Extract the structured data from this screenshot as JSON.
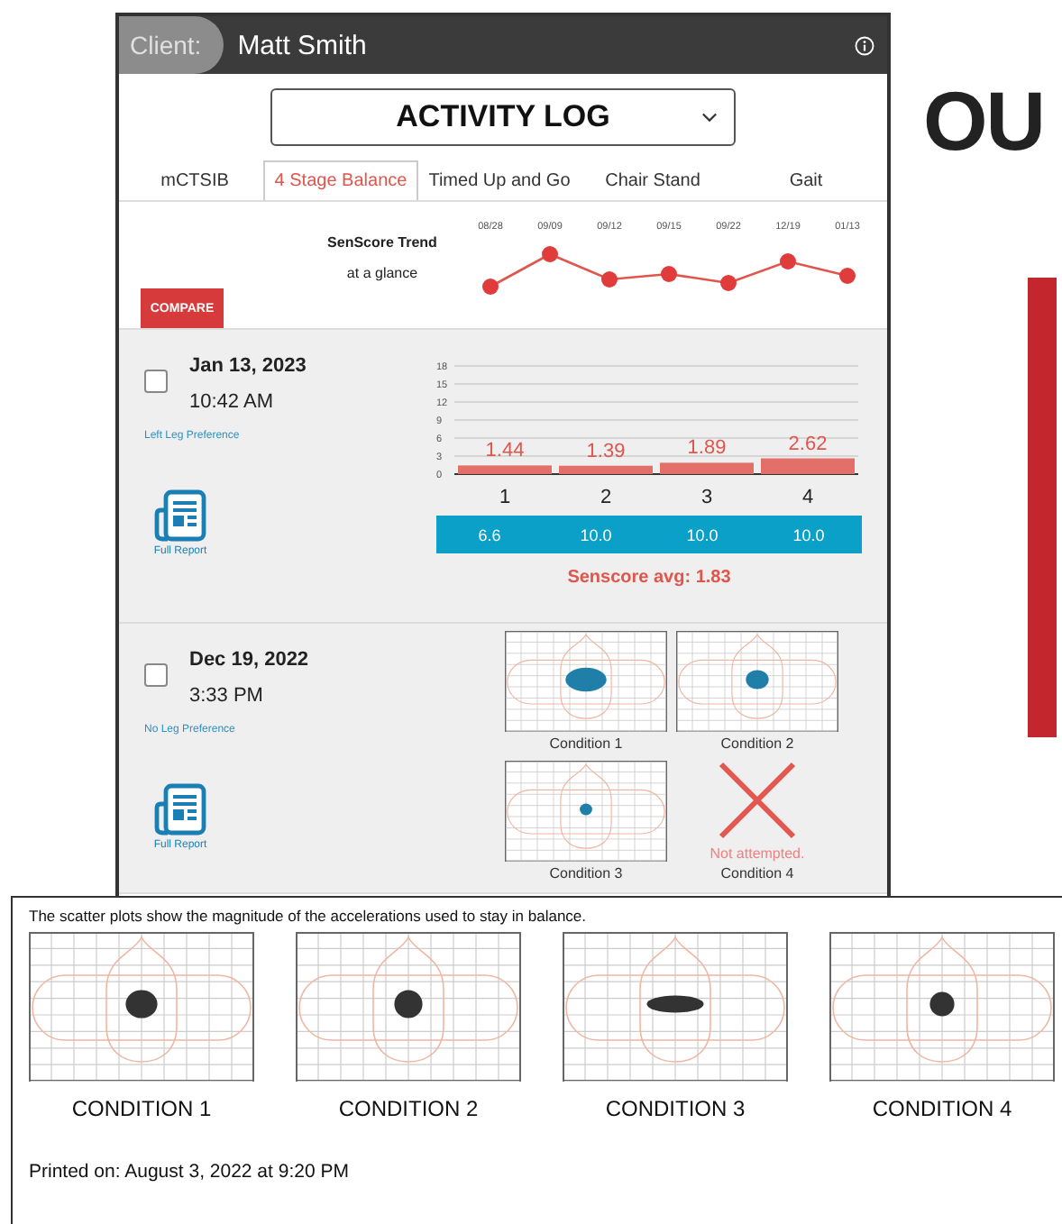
{
  "client": {
    "label": "Client:",
    "name": "Matt Smith"
  },
  "dropdown": {
    "value": "ACTIVITY LOG"
  },
  "tabs": [
    {
      "label": "mCTSIB",
      "selected": false
    },
    {
      "label": "4 Stage Balance",
      "selected": true
    },
    {
      "label": "Timed Up and Go",
      "selected": false
    },
    {
      "label": "Chair Stand",
      "selected": false
    },
    {
      "label": "Gait",
      "selected": false
    }
  ],
  "trend": {
    "title": "SenScore Trend",
    "subtitle": "at a glance",
    "dates": [
      "08/28",
      "09/09",
      "09/12",
      "09/15",
      "09/22",
      "12/19",
      "01/13"
    ]
  },
  "compare_button": "COMPARE",
  "sessions": [
    {
      "kind": "bars",
      "checked": false,
      "date": "Jan 13, 2023",
      "time": "10:42 AM",
      "preference": "Left Leg Preference",
      "report_label": "Full Report",
      "chart_data": {
        "type": "bar",
        "categories": [
          "1",
          "2",
          "3",
          "4"
        ],
        "values": [
          1.44,
          1.39,
          1.89,
          2.62
        ],
        "ylim": [
          0,
          18
        ],
        "yticks": [
          0,
          3,
          6,
          9,
          12,
          15,
          18
        ],
        "grid": true,
        "data_labels": true
      },
      "scores": [
        "6.6",
        "10.0",
        "10.0",
        "10.0"
      ],
      "average": "Senscore avg: 1.83"
    },
    {
      "kind": "conditions",
      "checked": false,
      "date": "Dec 19, 2022",
      "time": "3:33 PM",
      "preference": "No Leg Preference",
      "report_label": "Full Report",
      "conditions": [
        {
          "kind": "plot",
          "label": "Condition 1"
        },
        {
          "kind": "plot",
          "label": "Condition 2"
        },
        {
          "kind": "plot",
          "label": "Condition 3"
        },
        {
          "kind": "not_attempted",
          "label": "Condition 4"
        }
      ],
      "not_attempted_note": "Not attempted."
    }
  ],
  "background": {
    "heading": "OU"
  },
  "printout": {
    "caption": "The scatter plots show the magnitude of the accelerations used to stay in balance.",
    "conditions": [
      "CONDITION 1",
      "CONDITION 2",
      "CONDITION 3",
      "CONDITION 4"
    ],
    "printed": "Printed on: August 3, 2022 at 9:20 PM"
  }
}
